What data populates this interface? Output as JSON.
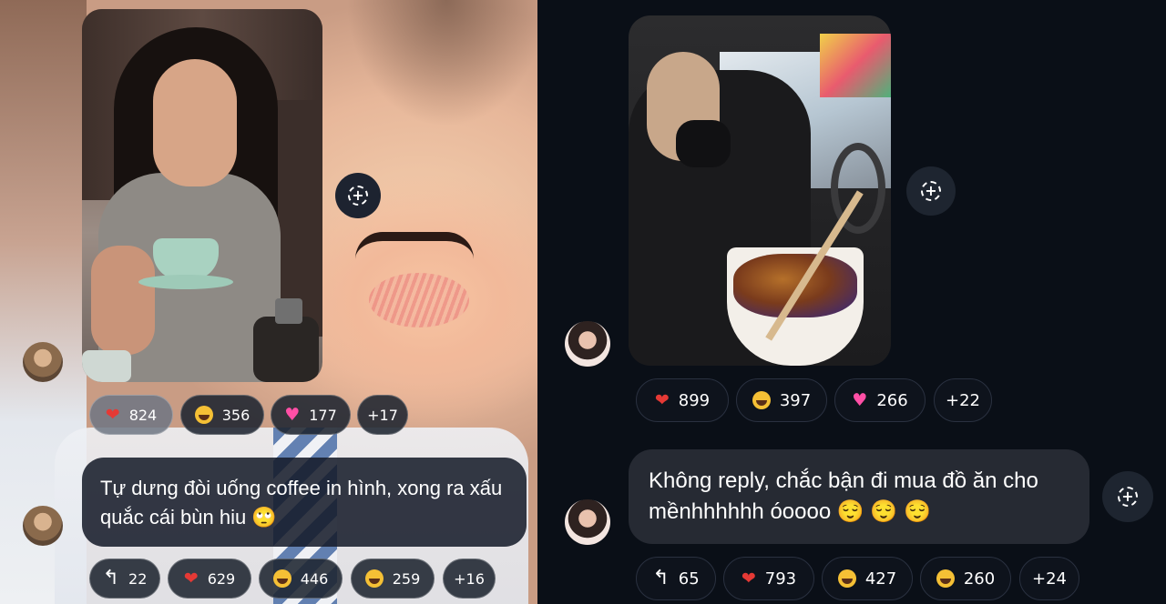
{
  "left": {
    "reactions_top": [
      {
        "icon": "heart",
        "count": "824"
      },
      {
        "icon": "laugh-tears",
        "count": "356"
      },
      {
        "icon": "pink-heart",
        "count": "177"
      },
      {
        "icon": "more",
        "count": "+17"
      }
    ],
    "message": "Tự dưng đòi uống coffee in hình, xong ra xấu quắc cái bùn hiu 🙄",
    "reactions_bottom": [
      {
        "icon": "reply",
        "count": "22"
      },
      {
        "icon": "heart",
        "count": "629"
      },
      {
        "icon": "laugh-tears",
        "count": "446"
      },
      {
        "icon": "grin-squint",
        "count": "259"
      },
      {
        "icon": "more",
        "count": "+16"
      }
    ]
  },
  "right": {
    "reactions_top": [
      {
        "icon": "heart",
        "count": "899"
      },
      {
        "icon": "laugh-tears",
        "count": "397"
      },
      {
        "icon": "pink-heart",
        "count": "266"
      },
      {
        "icon": "more",
        "count": "+22"
      }
    ],
    "message": "Không reply, chắc bận đi mua đồ ăn cho mềnhhhhhh óoooo 😌 😌 😌",
    "reactions_bottom": [
      {
        "icon": "reply",
        "count": "65"
      },
      {
        "icon": "heart",
        "count": "793"
      },
      {
        "icon": "laugh-tears",
        "count": "427"
      },
      {
        "icon": "grin-squint",
        "count": "260"
      },
      {
        "icon": "more",
        "count": "+24"
      }
    ]
  },
  "colors": {
    "dark_bg": "#0a0f17",
    "pill_border": "#2a3140",
    "heart": "#e53935",
    "pink_heart": "#ff4fa6",
    "emoji_yellow": "#f5c035"
  }
}
